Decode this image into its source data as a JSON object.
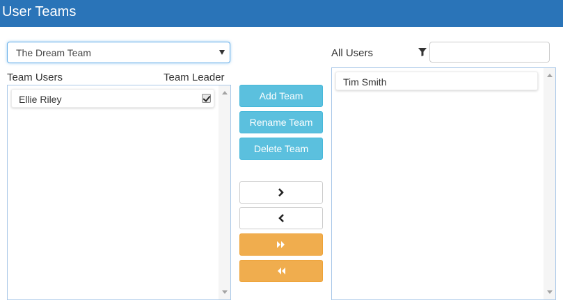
{
  "header": {
    "title": "User Teams"
  },
  "team_select": {
    "selected": "The Dream Team"
  },
  "team_users": {
    "label": "Team Users",
    "leader_label": "Team Leader",
    "items": [
      {
        "name": "Ellie Riley",
        "leader": true
      }
    ]
  },
  "actions": {
    "add_team": "Add Team",
    "rename_team": "Rename Team",
    "delete_team": "Delete Team"
  },
  "transfer": {
    "move_right_icon": "chevron-right-icon",
    "move_left_icon": "chevron-left-icon",
    "move_all_right_icon": "double-chevron-right-icon",
    "move_all_left_icon": "double-chevron-left-icon"
  },
  "all_users": {
    "label": "All Users",
    "filter_value": "",
    "items": [
      {
        "name": "Tim Smith"
      }
    ]
  },
  "colors": {
    "header": "#2a74b8",
    "primary_button": "#5bc0de",
    "transfer_all_button": "#f0ad4e"
  }
}
